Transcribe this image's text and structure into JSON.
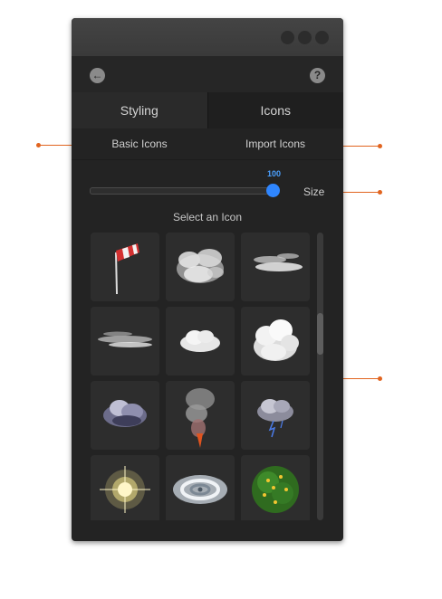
{
  "toolbar": {
    "back_icon": "back-arrow-icon",
    "help_icon": "help-icon"
  },
  "tabs": [
    {
      "label": "Styling"
    },
    {
      "label": "Icons"
    }
  ],
  "subtabs": [
    {
      "label": "Basic Icons"
    },
    {
      "label": "Import Icons"
    }
  ],
  "size": {
    "label": "Size",
    "value": "100"
  },
  "picker": {
    "label": "Select an Icon"
  },
  "icons": [
    "windsock-icon",
    "cloud-cluster-icon",
    "wispy-clouds-icon",
    "streak-clouds-icon",
    "small-cloud-icon",
    "cumulus-cloud-icon",
    "dark-cloud-icon",
    "smoke-plume-icon",
    "storm-cloud-icon",
    "sun-icon",
    "hurricane-icon",
    "tree-icon"
  ],
  "colors": {
    "accent": "#2f86ff",
    "callout": "#e1641f",
    "panel": "#232323"
  }
}
